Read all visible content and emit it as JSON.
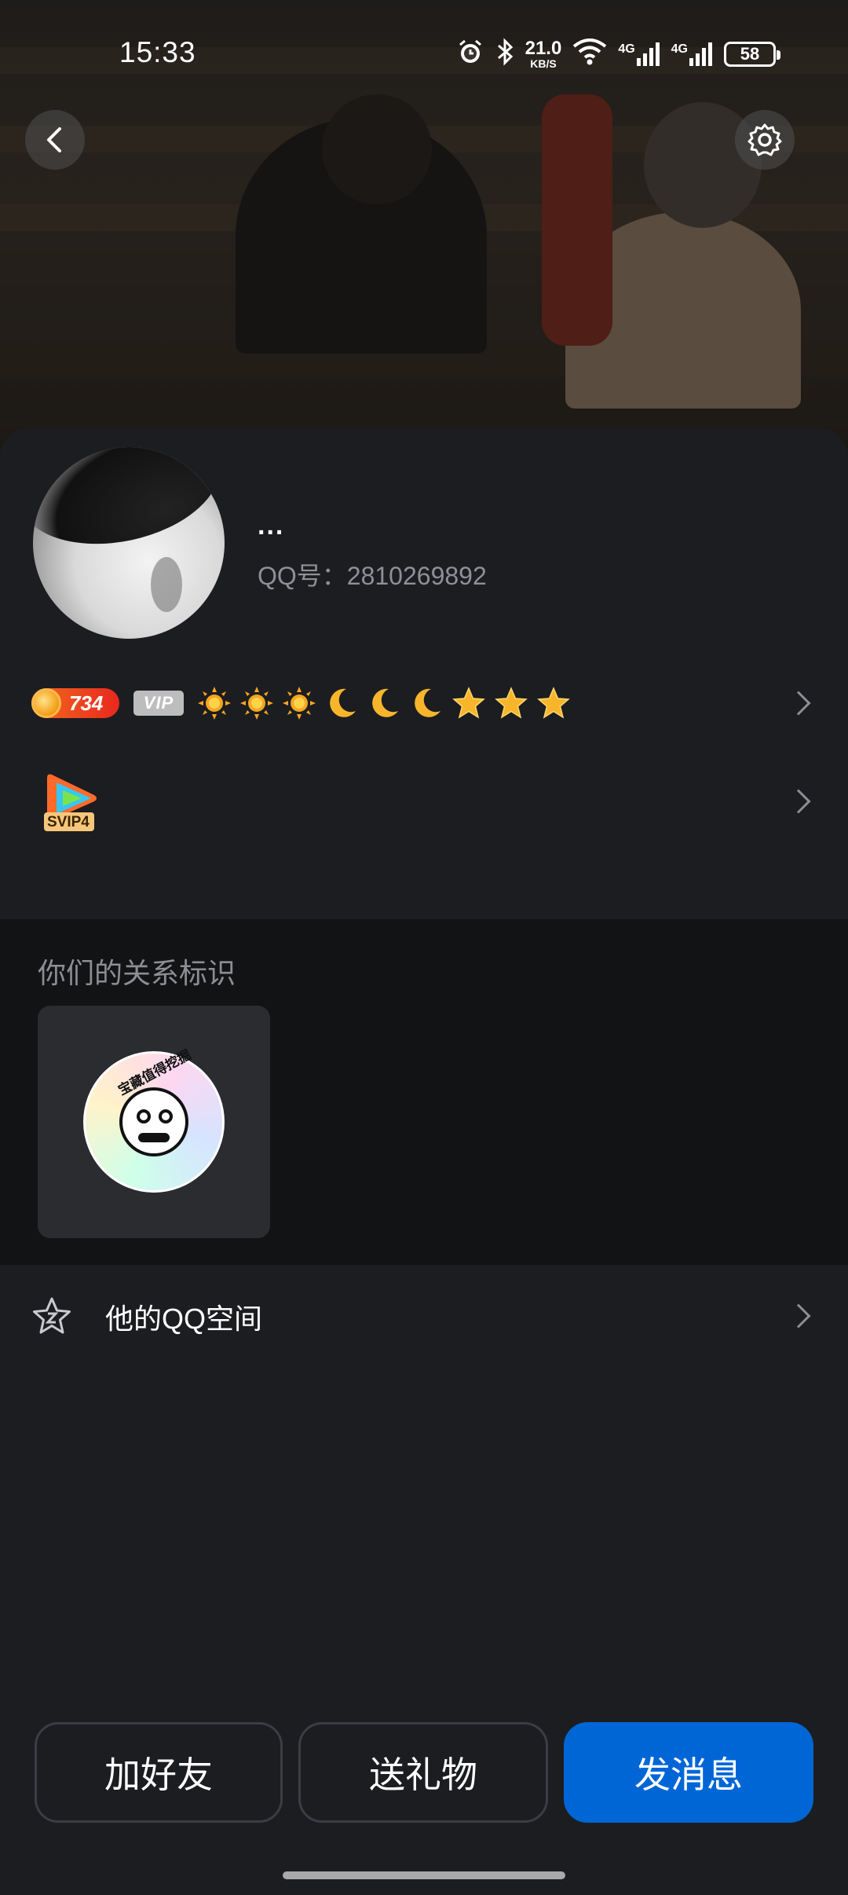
{
  "status_bar": {
    "time": "15:33",
    "net_speed_value": "21.0",
    "net_speed_unit": "KB/S",
    "sim1": "4G",
    "sim2": "4G",
    "battery": "58"
  },
  "profile": {
    "nickname": "...",
    "qq_number": "QQ号：2810269892",
    "coin_count": "734",
    "vip_label": "VIP",
    "level_icons": [
      "sun",
      "sun",
      "sun",
      "moon",
      "moon",
      "moon",
      "star",
      "star",
      "star"
    ],
    "svip_label": "SVIP4"
  },
  "relationship": {
    "title": "你们的关系标识",
    "sticker_ring_text": "宝藏值得挖掘"
  },
  "qzone": {
    "label": "他的QQ空间"
  },
  "actions": {
    "add_friend": "加好友",
    "send_gift": "送礼物",
    "send_message": "发消息"
  },
  "colors": {
    "primary_button": "#0066d6",
    "background": "#1c1d20",
    "section_dark": "#121315",
    "secondary_text": "#8f9095"
  }
}
